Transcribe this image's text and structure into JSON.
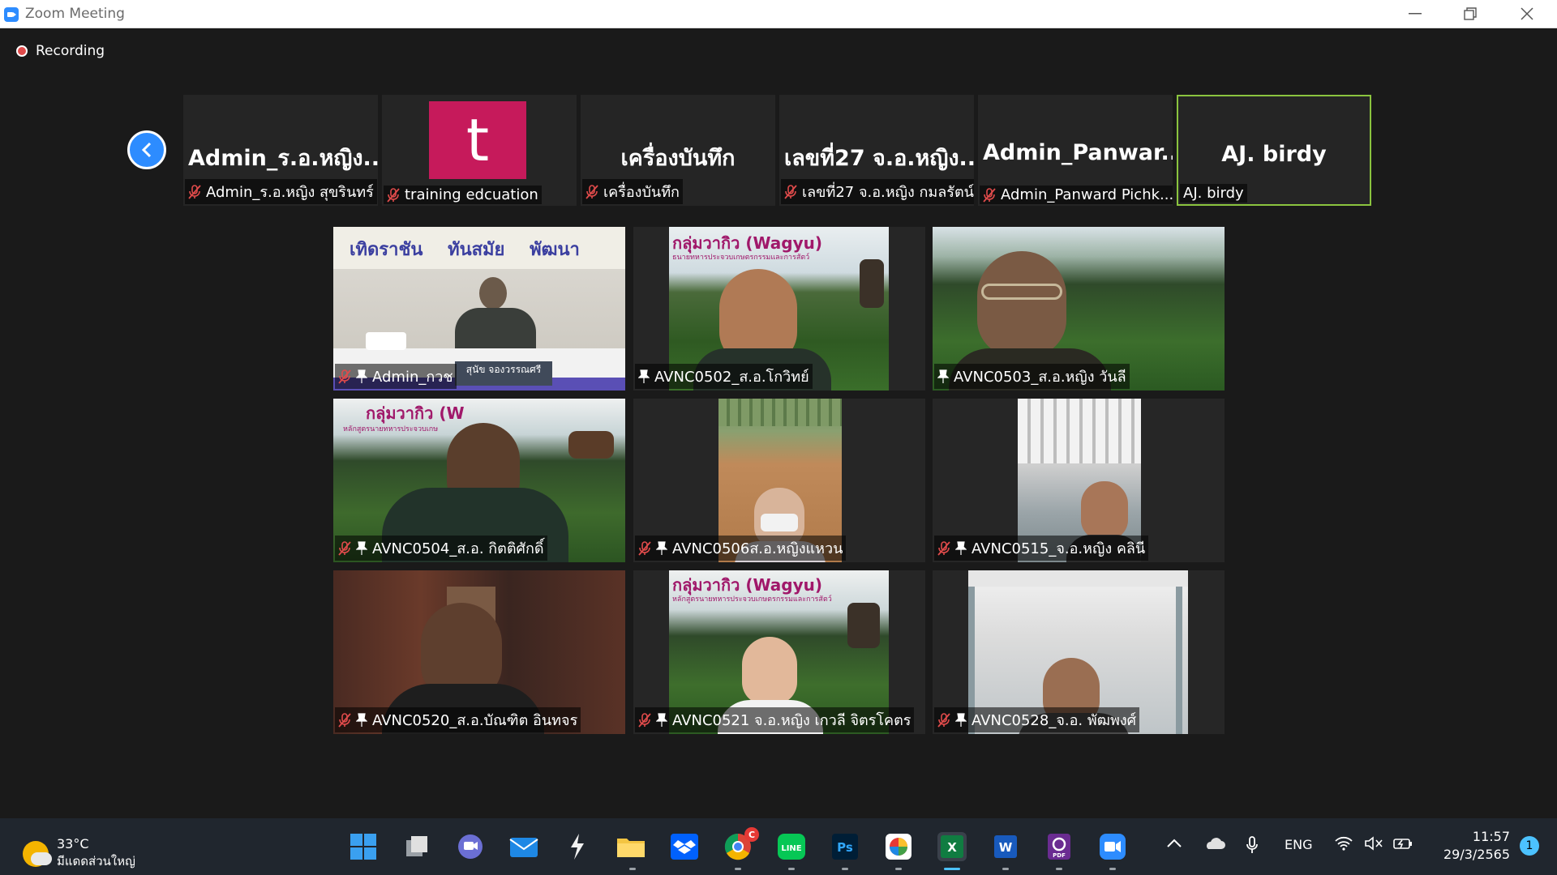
{
  "window": {
    "title": "Zoom Meeting",
    "icon": "zoom-icon"
  },
  "recording": {
    "label": "Recording",
    "color": "#e04b4b"
  },
  "strip": {
    "tiles": [
      {
        "big": "Admin_ร.อ.หญิง...",
        "label": "Admin_ร.อ.หญิง สุขรินทร์",
        "muted": true
      },
      {
        "avatar_letter": "t",
        "avatar_color": "#c61a5b",
        "label": "training edcuation",
        "muted": true
      },
      {
        "big": "เครื่องบันทึก",
        "label": "เครื่องบันทึก",
        "muted": true
      },
      {
        "big": "เลขที่27 จ.อ.หญิง...",
        "label": "เลขที่27 จ.อ.หญิง กมลรัตน์...",
        "muted": true
      },
      {
        "big": "Admin_Panwar...",
        "label": "Admin_Panward  Pichk...",
        "muted": true
      },
      {
        "big": "AJ. birdy",
        "label": "AJ. birdy",
        "muted": false,
        "active": true
      }
    ]
  },
  "grid": {
    "tiles": [
      {
        "label": "Admin_กวช",
        "muted": true,
        "pinned": true,
        "banner": "เทิดราชัน    ทันสมัย    พัฒนา",
        "plaque": "สุนัข  จองวรรณศรี"
      },
      {
        "label": "AVNC0502_ส.อ.โกวิทย์",
        "muted": false,
        "pinned": true,
        "banner": "กลุ่มวากิว (Wagyu)",
        "subbanner": "ธนายทหารประจวบเกษตรกรรมและการสัตว์"
      },
      {
        "label": "AVNC0503_ส.อ.หญิง วันลี",
        "muted": false,
        "pinned": true
      },
      {
        "label": "AVNC0504_ส.อ. กิตติศักดิ์",
        "muted": true,
        "pinned": true,
        "banner": "กลุ่มวากิว (W",
        "subbanner": "หลักสูตรนายทหารประจวบเกษ"
      },
      {
        "label": "AVNC0506ส.อ.หญิงแหวน",
        "muted": true,
        "pinned": true
      },
      {
        "label": "AVNC0515_จ.อ.หญิง คลินี",
        "muted": true,
        "pinned": true
      },
      {
        "label": "AVNC0520_ส.อ.บัณฑิต อินทจร",
        "muted": true,
        "pinned": true
      },
      {
        "label": "AVNC0521 จ.อ.หญิง เกวลี จิตรโคตร",
        "muted": true,
        "pinned": true,
        "banner": "กลุ่มวากิว (Wagyu)",
        "subbanner": "หลักสูตรนายทหารประจวบเกษตรกรรมและการสัตว์"
      },
      {
        "label": "AVNC0528_จ.อ. พัฒพงศ์",
        "muted": true,
        "pinned": true
      }
    ]
  },
  "taskbar": {
    "weather": {
      "temp": "33°C",
      "condition": "มีแดดส่วนใหญ่"
    },
    "apps": [
      "windows-start-icon",
      "task-view-icon",
      "teams-chat-icon",
      "mail-icon",
      "winamp-icon",
      "file-explorer-icon",
      "dropbox-icon",
      "chrome-icon",
      "line-icon",
      "photoshop-icon",
      "picasa-icon",
      "excel-icon",
      "word-icon",
      "pdf-icon",
      "zoom-icon"
    ],
    "chrome_badge": "C",
    "tray": {
      "lang": "ENG"
    },
    "clock": {
      "time": "11:57",
      "date": "29/3/2565"
    },
    "notifications": "1"
  }
}
